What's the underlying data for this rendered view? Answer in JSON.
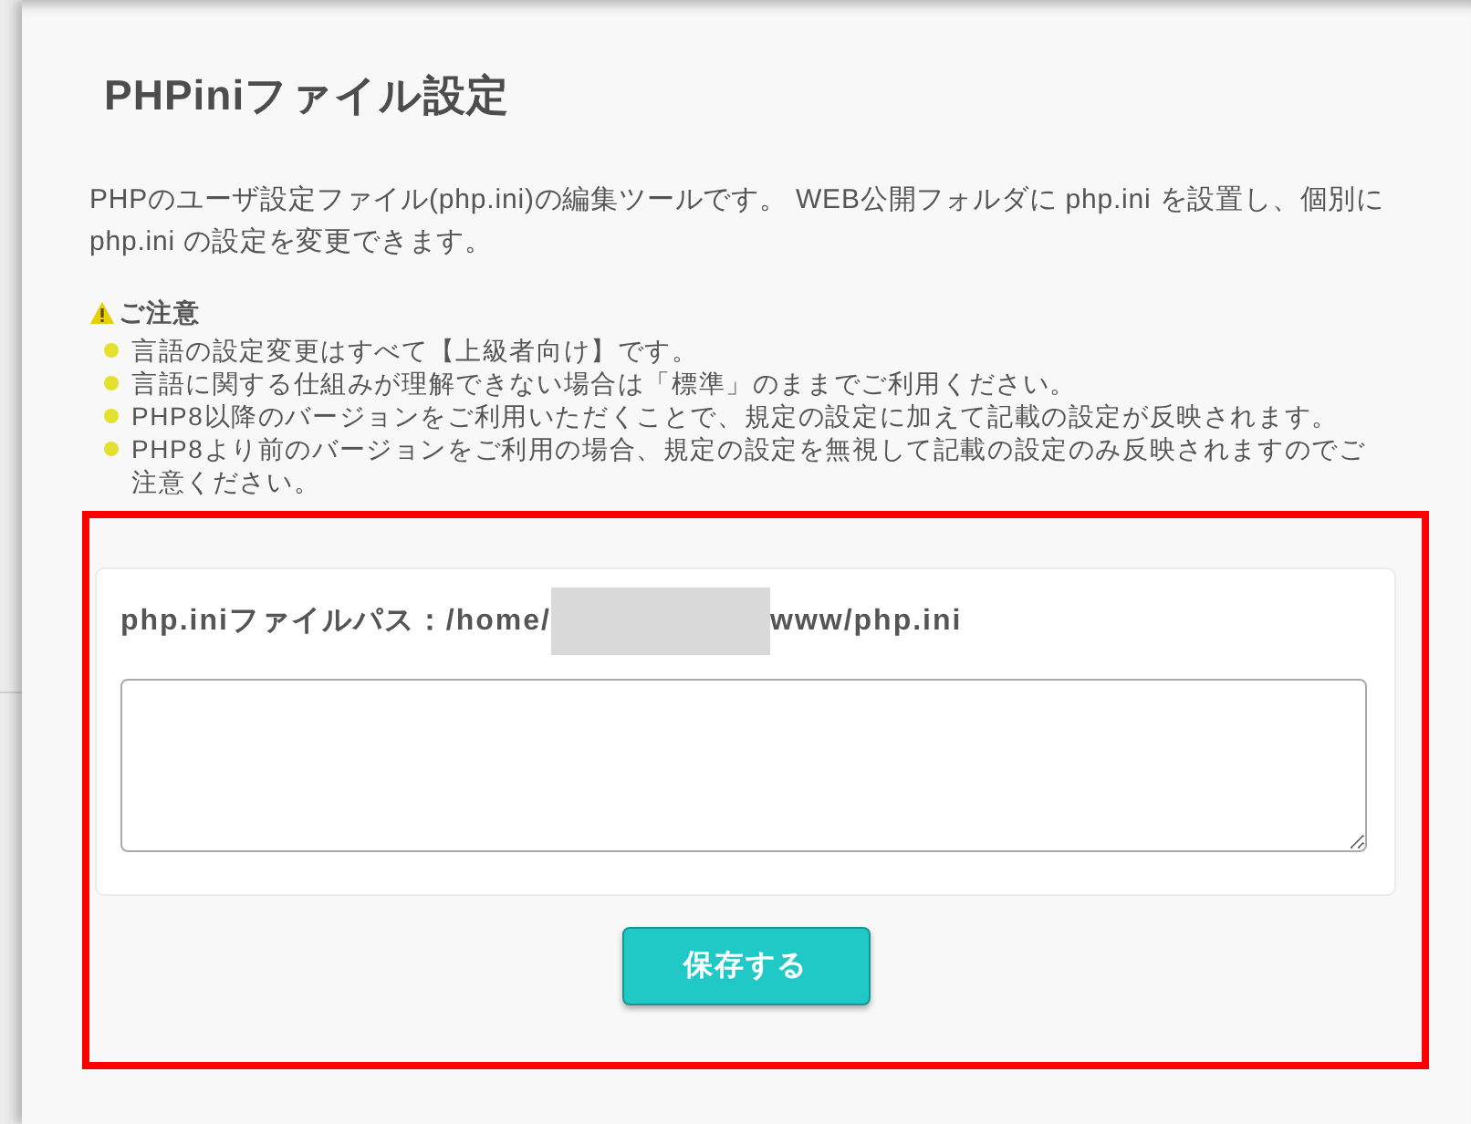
{
  "page": {
    "title": "PHPiniファイル設定",
    "description": "PHPのユーザ設定ファイル(php.ini)の編集ツールです。 WEB公開フォルダに php.ini を設置し、個別に php.ini の設定を変更できます。"
  },
  "notice": {
    "heading": "ご注意",
    "items": [
      "言語の設定変更はすべて【上級者向け】です。",
      "言語に関する仕組みが理解できない場合は「標準」のままでご利用ください。",
      "PHP8以降のバージョンをご利用いただくことで、規定の設定に加えて記載の設定が反映されます。",
      "PHP8より前のバージョンをご利用の場合、規定の設定を無視して記載の設定のみ反映されますのでご注意ください。"
    ]
  },
  "editor": {
    "path_label": "php.iniファイルパス：/home/",
    "path_suffix": "www/php.ini"
  },
  "save_button": "保存する"
}
